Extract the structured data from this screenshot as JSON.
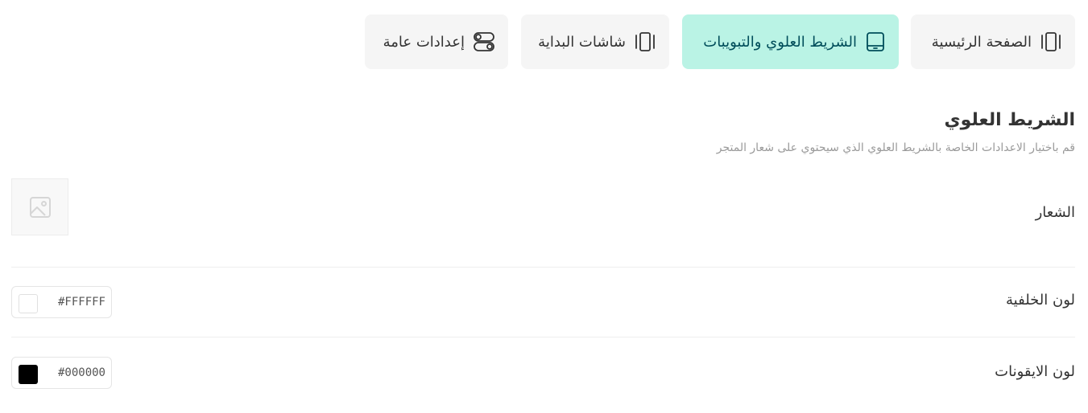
{
  "tabs": [
    {
      "id": "home",
      "label": "الصفحة الرئيسية",
      "icon": "carousel-icon",
      "active": false
    },
    {
      "id": "header",
      "label": "الشريط العلوي والتبويبات",
      "icon": "tablet-icon",
      "active": true
    },
    {
      "id": "splash",
      "label": "شاشات البداية",
      "icon": "carousel-icon",
      "active": false
    },
    {
      "id": "general",
      "label": "إعدادات عامة",
      "icon": "toggle-settings-icon",
      "active": false
    }
  ],
  "section": {
    "title": "الشريط العلوي",
    "description": "قم باختيار الاعدادات الخاصة بالشريط العلوي الذي سيحتوي على شعار المتجر"
  },
  "fields": {
    "logo": {
      "label": "الشعار",
      "icon": "image-placeholder-icon"
    },
    "background_color": {
      "label": "لون الخلفية",
      "value": "#FFFFFF",
      "swatch": "#ffffff"
    },
    "icons_color": {
      "label": "لون الايقونات",
      "value": "#000000",
      "swatch": "#000000"
    }
  },
  "colors": {
    "active_tab": "#baf3e5",
    "inactive_tab": "#f5f5f5",
    "active_text": "#004d5a"
  }
}
